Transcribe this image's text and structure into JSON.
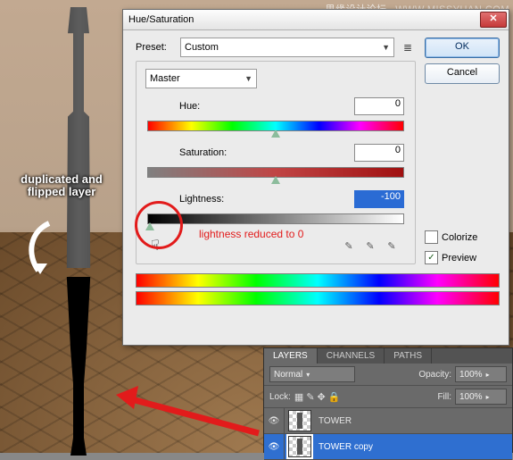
{
  "watermark": {
    "cn": "思缘设计论坛",
    "en": "WWW.MISSYUAN.COM"
  },
  "annotation": {
    "dup_flip": "duplicated and flipped layer",
    "light0": "lightness reduced to 0"
  },
  "dialog": {
    "title": "Hue/Saturation",
    "preset_label": "Preset:",
    "preset_value": "Custom",
    "channel": "Master",
    "hue_label": "Hue:",
    "hue_value": "0",
    "sat_label": "Saturation:",
    "sat_value": "0",
    "light_label": "Lightness:",
    "light_value": "-100",
    "ok": "OK",
    "cancel": "Cancel",
    "colorize_label": "Colorize",
    "preview_label": "Preview",
    "preview_checked": "✓"
  },
  "layers": {
    "tabs": [
      "LAYERS",
      "CHANNELS",
      "PATHS"
    ],
    "blend": "Normal",
    "opacity_label": "Opacity:",
    "opacity_value": "100%",
    "lock_label": "Lock:",
    "fill_label": "Fill:",
    "fill_value": "100%",
    "items": [
      {
        "name": "TOWER"
      },
      {
        "name": "TOWER copy"
      }
    ],
    "eye": "👁"
  }
}
